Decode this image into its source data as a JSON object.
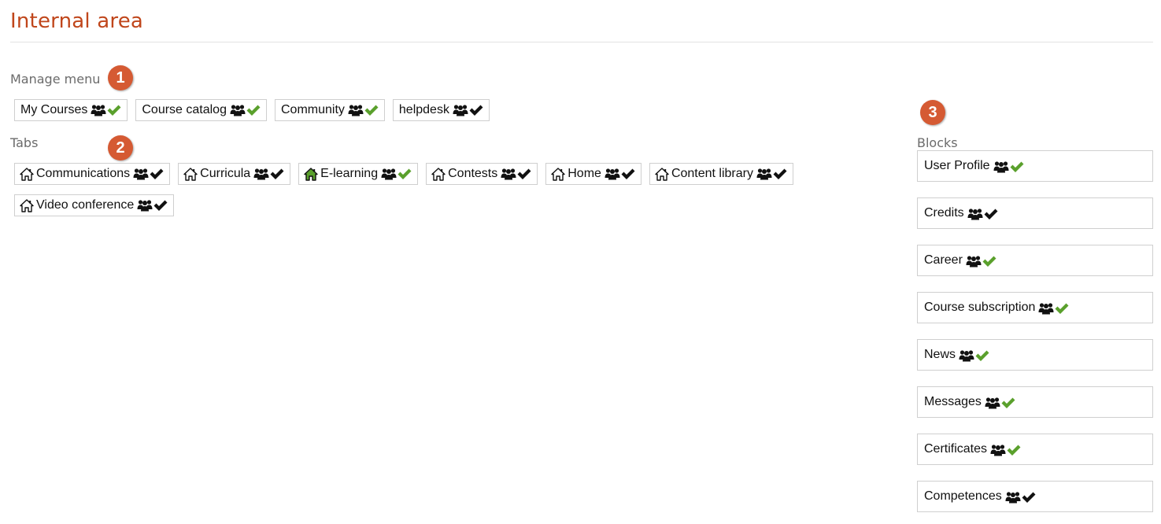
{
  "page": {
    "title": "Internal area"
  },
  "colors": {
    "accent": "#c0461b",
    "badge": "#d55a33",
    "check_active": "#5aa02c",
    "check_inactive": "#111111",
    "home_active": "#5aa02c"
  },
  "sections": {
    "manage_menu": {
      "label": "Manage menu",
      "badge": "1"
    },
    "tabs": {
      "label": "Tabs",
      "badge": "2"
    },
    "blocks": {
      "label": "Blocks",
      "badge": "3"
    }
  },
  "menu_items": [
    {
      "label": "My Courses",
      "active": true
    },
    {
      "label": "Course catalog",
      "active": true
    },
    {
      "label": "Community",
      "active": true
    },
    {
      "label": "helpdesk",
      "active": false
    }
  ],
  "tab_items": [
    {
      "label": "Communications",
      "home_active": false,
      "active": false
    },
    {
      "label": "Curricula",
      "home_active": false,
      "active": false
    },
    {
      "label": "E-learning",
      "home_active": true,
      "active": true
    },
    {
      "label": "Contests",
      "home_active": false,
      "active": false
    },
    {
      "label": "Home",
      "home_active": false,
      "active": false
    },
    {
      "label": "Content library",
      "home_active": false,
      "active": false
    },
    {
      "label": "Video conference",
      "home_active": false,
      "active": false
    }
  ],
  "block_items": [
    {
      "label": "User Profile",
      "active": true
    },
    {
      "label": "Credits",
      "active": false
    },
    {
      "label": "Career",
      "active": true
    },
    {
      "label": "Course subscription",
      "active": true
    },
    {
      "label": "News",
      "active": true
    },
    {
      "label": "Messages",
      "active": true
    },
    {
      "label": "Certificates",
      "active": true
    },
    {
      "label": "Competences",
      "active": false
    }
  ]
}
